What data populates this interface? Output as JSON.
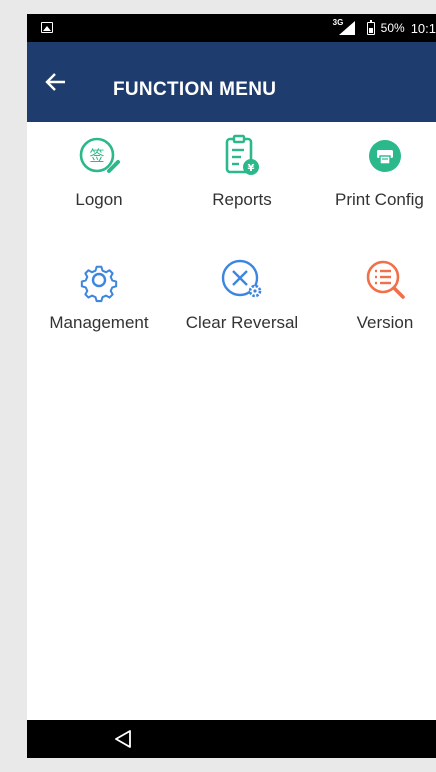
{
  "status_bar": {
    "network": "3G",
    "battery_percent": "50%",
    "time": "10:1"
  },
  "app_bar": {
    "title": "FUNCTION MENU"
  },
  "menu": {
    "items": [
      {
        "label": "Logon",
        "icon": "logon-sign-icon",
        "color": "#2bb88a"
      },
      {
        "label": "Reports",
        "icon": "reports-clipboard-icon",
        "color": "#2bb88a"
      },
      {
        "label": "Print Config",
        "icon": "printer-icon",
        "color": "#2bb88a"
      },
      {
        "label": "Management",
        "icon": "gear-icon",
        "color": "#3d86e0"
      },
      {
        "label": "Clear Reversal",
        "icon": "clear-reversal-icon",
        "color": "#3d86e0"
      },
      {
        "label": "Version",
        "icon": "version-search-icon",
        "color": "#f0704a"
      }
    ]
  },
  "colors": {
    "app_bar": "#1e3d6e",
    "green_icon": "#2bb88a",
    "blue_icon": "#3d86e0",
    "orange_icon": "#f0704a"
  }
}
